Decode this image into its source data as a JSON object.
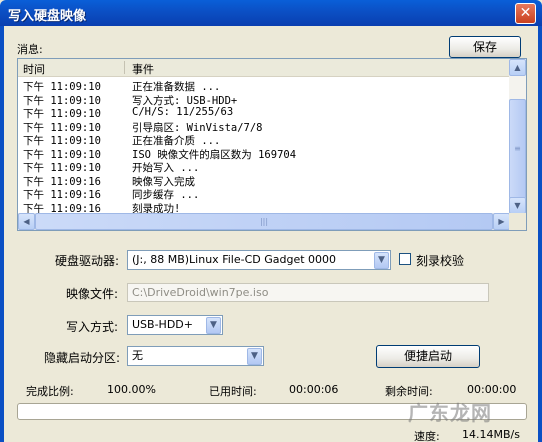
{
  "window": {
    "title": "写入硬盘映像",
    "close_glyph": "✕"
  },
  "messages_label": "消息:",
  "save_button": "保存",
  "log": {
    "columns": [
      "时间",
      "事件"
    ],
    "rows": [
      {
        "time": "下午 11:09:10",
        "event": "正在准备数据 ..."
      },
      {
        "time": "下午 11:09:10",
        "event": "写入方式: USB-HDD+"
      },
      {
        "time": "下午 11:09:10",
        "event": "C/H/S: 11/255/63"
      },
      {
        "time": "下午 11:09:10",
        "event": "引导扇区: WinVista/7/8"
      },
      {
        "time": "下午 11:09:10",
        "event": "正在准备介质 ..."
      },
      {
        "time": "下午 11:09:10",
        "event": "ISO 映像文件的扇区数为 169704"
      },
      {
        "time": "下午 11:09:10",
        "event": "开始写入 ..."
      },
      {
        "time": "下午 11:09:16",
        "event": "映像写入完成"
      },
      {
        "time": "下午 11:09:16",
        "event": "同步缓存 ..."
      },
      {
        "time": "下午 11:09:16",
        "event": "刻录成功!"
      }
    ]
  },
  "drive": {
    "label": "硬盘驱动器:",
    "value": "(J:, 88 MB)Linux   File-CD Gadget  0000",
    "verify_label": "刻录校验",
    "verify_checked": false
  },
  "image_file": {
    "label": "映像文件:",
    "value": "C:\\DriveDroid\\win7pe.iso"
  },
  "write_mode": {
    "label": "写入方式:",
    "value": "USB-HDD+"
  },
  "hidden_partition": {
    "label": "隐藏启动分区:",
    "value": "无"
  },
  "quick_boot_button": "便捷启动",
  "status": {
    "complete_label": "完成比例:",
    "complete_value": "100.00%",
    "elapsed_label": "已用时间:",
    "elapsed_value": "00:00:06",
    "remaining_label": "剩余时间:",
    "remaining_value": "00:00:00",
    "speed_label": "速度:",
    "speed_value": "14.14MB/s"
  },
  "progress_fraction": 0,
  "watermark": "广东龙网"
}
